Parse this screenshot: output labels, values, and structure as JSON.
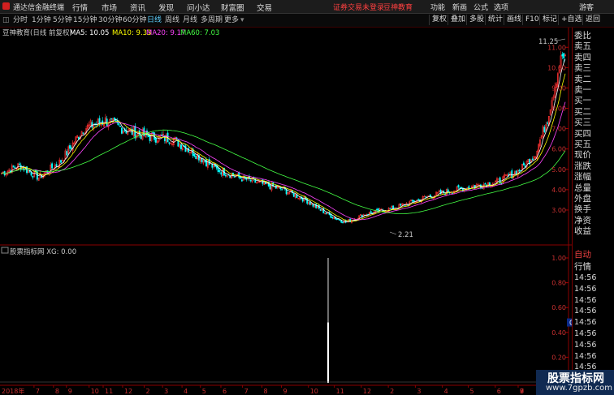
{
  "app": {
    "title": "通达信金融终端"
  },
  "menu": [
    "行情",
    "市场",
    "资讯",
    "发现",
    "问小达",
    "财富圈",
    "交易"
  ],
  "menu_right": {
    "login_notice": "证券交易未登录",
    "stock_title": "豆神教育",
    "function": "功能",
    "news": "新画",
    "formula": "公式",
    "options": "选项",
    "guest": "游客"
  },
  "toolbar": {
    "periods": [
      "分时",
      "1分钟",
      "5分钟",
      "15分钟",
      "30分钟",
      "60分钟",
      "日线",
      "周线",
      "月线",
      "多周期",
      "更多"
    ],
    "active_period": "日线",
    "right_buttons": [
      "复权",
      "叠加",
      "多股",
      "统计",
      "画线",
      "F10",
      "标记",
      "+自选",
      "返回"
    ]
  },
  "main_chart": {
    "title": "豆神教育(日线 前复权)",
    "ma_labels": [
      {
        "text": "MA5: 10.05",
        "color": "#ffffff"
      },
      {
        "text": "MA10: 9.33",
        "color": "#ffff00"
      },
      {
        "text": "MA20: 9.17",
        "color": "#ff44ff"
      },
      {
        "text": "MA60: 7.03",
        "color": "#44ff44"
      }
    ],
    "price_ticks": [
      "11.00",
      "10.00",
      "9.00",
      "8.00",
      "7.00",
      "6.00",
      "5.00",
      "4.00",
      "3.00"
    ],
    "high_label": "11.25",
    "low_label": "2.21",
    "colors": {
      "up": "#ff3232",
      "down": "#00ffff",
      "ma5": "#ffffff",
      "ma10": "#ffff00",
      "ma20": "#ff44ff",
      "ma60": "#44ff44",
      "grid": "#6a0000"
    }
  },
  "indicator": {
    "title": "股票指标网 XG: 0.00",
    "ticks": [
      "1.00",
      "0.80",
      "0.60",
      "0.40",
      "0.20"
    ],
    "current_value": "0.48",
    "spike_value": 1.0,
    "spike_mid_value": 0.48
  },
  "x_axis": {
    "year": "2018年",
    "months": [
      "7",
      "8",
      "9",
      "10",
      "11",
      "12",
      "2",
      "3",
      "4",
      "5",
      "6",
      "7",
      "8",
      "9",
      "10",
      "11",
      "12",
      "2",
      "3",
      "4",
      "5",
      "6",
      "7",
      "8",
      "9"
    ]
  },
  "side_panel": {
    "labels": [
      "委比",
      "卖五",
      "卖四",
      "卖三",
      "卖二",
      "卖一",
      "买一",
      "买二",
      "买三",
      "买四",
      "买五",
      "现价",
      "涨跌",
      "涨幅",
      "总量",
      "外盘",
      "换手",
      "净资",
      "收益"
    ],
    "auto_label": "自动",
    "quote_label": "行情",
    "times": [
      "14:56",
      "14:56",
      "14:56",
      "14:56",
      "14:56",
      "14:56",
      "14:56",
      "14:56",
      "14:56",
      "14:56",
      "14:56"
    ]
  },
  "watermark": {
    "line1": "股票指标网",
    "line2": "www.7gpzb.com"
  }
}
